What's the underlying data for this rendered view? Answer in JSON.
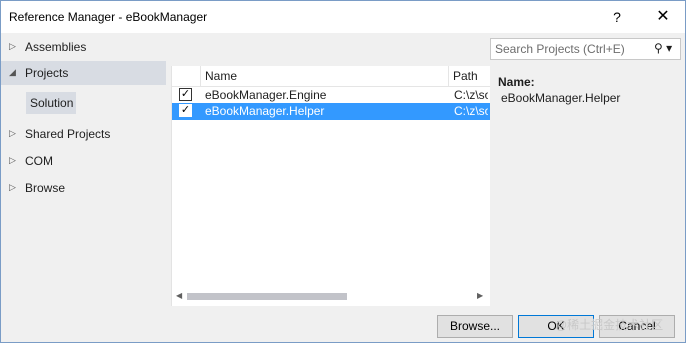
{
  "window": {
    "title": "Reference Manager - eBookManager",
    "help_label": "?",
    "close_label": "✕"
  },
  "nav": {
    "items": [
      {
        "label": "Assemblies",
        "expanded": false
      },
      {
        "label": "Projects",
        "expanded": true
      },
      {
        "label": "Shared Projects",
        "expanded": false
      },
      {
        "label": "COM",
        "expanded": false
      },
      {
        "label": "Browse",
        "expanded": false
      }
    ],
    "sub_item": "Solution"
  },
  "list": {
    "columns": [
      "Name",
      "Path"
    ],
    "rows": [
      {
        "checked": true,
        "name": "eBookManager.Engine",
        "path": "C:\\z\\so",
        "selected": false
      },
      {
        "checked": true,
        "name": "eBookManager.Helper",
        "path": "C:\\z\\so",
        "selected": true
      }
    ]
  },
  "search": {
    "placeholder": "Search Projects (Ctrl+E)",
    "icon": "search-icon"
  },
  "details": {
    "label": "Name:",
    "value": "eBookManager.Helper"
  },
  "buttons": {
    "browse": "Browse...",
    "ok": "OK",
    "cancel": "Cancel"
  },
  "watermark": "@稀土掘金技术社区",
  "colors": {
    "selection": "#3399ff",
    "nav_selection": "#d8dce3",
    "ok_border": "#0078d7"
  }
}
